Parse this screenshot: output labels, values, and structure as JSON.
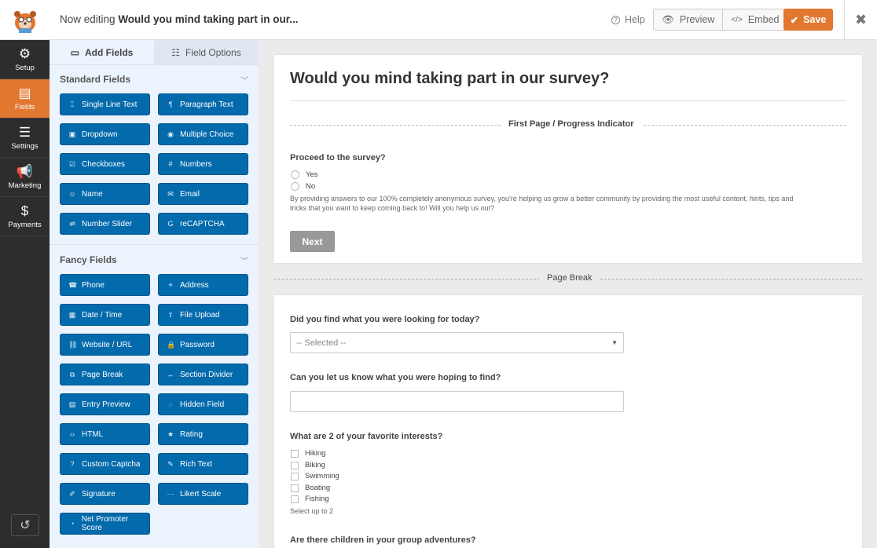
{
  "header": {
    "editing_prefix": "Now editing",
    "form_name": "Would you mind taking part in our...",
    "help": "Help",
    "preview": "Preview",
    "embed": "Embed",
    "save": "Save"
  },
  "nav": {
    "items": [
      {
        "label": "Setup",
        "icon": "gear-icon"
      },
      {
        "label": "Fields",
        "icon": "fields-icon"
      },
      {
        "label": "Settings",
        "icon": "sliders-icon"
      },
      {
        "label": "Marketing",
        "icon": "megaphone-icon"
      },
      {
        "label": "Payments",
        "icon": "dollar-icon"
      }
    ],
    "active": "Fields"
  },
  "panel": {
    "tabs": [
      "Add Fields",
      "Field Options"
    ],
    "standard_title": "Standard Fields",
    "standard": [
      "Single Line Text",
      "Paragraph Text",
      "Dropdown",
      "Multiple Choice",
      "Checkboxes",
      "Numbers",
      "Name",
      "Email",
      "Number Slider",
      "reCAPTCHA"
    ],
    "fancy_title": "Fancy Fields",
    "fancy": [
      "Phone",
      "Address",
      "Date / Time",
      "File Upload",
      "Website / URL",
      "Password",
      "Page Break",
      "Section Divider",
      "Entry Preview",
      "Hidden Field",
      "HTML",
      "Rating",
      "Custom Captcha",
      "Rich Text",
      "Signature",
      "Likert Scale",
      "Net Promoter Score"
    ]
  },
  "form": {
    "title": "Would you mind taking part in our survey?",
    "divider": "First Page / Progress Indicator",
    "q1": "Proceed to the survey?",
    "q1_options": [
      "Yes",
      "No"
    ],
    "q1_desc_line1": "By providing answers to our 100% completely anonymous survey, you're helping us grow a better community by providing the most useful content, hints, tips and",
    "q1_desc_line2": "tricks that you want to keep coming back to! Will you help us out?",
    "next": "Next",
    "page_break": "Page Break",
    "q2": "Did you find what you were looking for today?",
    "q2_placeholder": "-- Selected --",
    "q3": "Can you let us know what you were hoping to find?",
    "q4": "What are 2 of your favorite interests?",
    "q4_options": [
      "Hiking",
      "Biking",
      "Swimming",
      "Boating",
      "Fishing"
    ],
    "q4_sub": "Select up to 2",
    "q5": "Are there children in your group adventures?"
  },
  "colors": {
    "accent": "#e27730",
    "field_button": "#036aab",
    "nav_bg": "#2d2d2d",
    "panel_bg": "#ebf3fc"
  }
}
